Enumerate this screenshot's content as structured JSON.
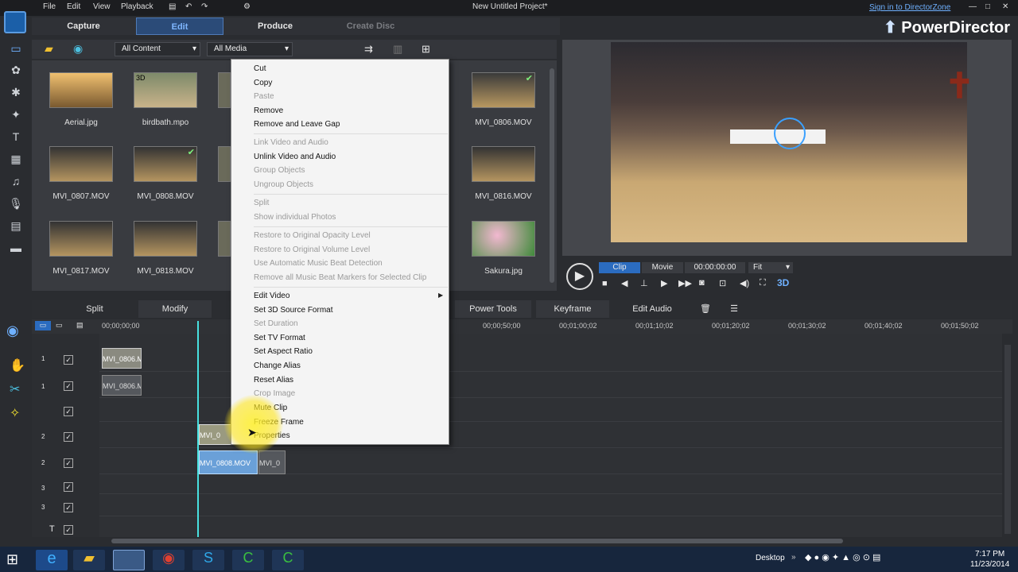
{
  "window": {
    "title": "New Untitled Project*",
    "menus": [
      "File",
      "Edit",
      "View",
      "Playback"
    ],
    "signin_link": "Sign in to DirectorZone",
    "brand": "PowerDirector"
  },
  "modes": [
    "Capture",
    "Edit",
    "Produce",
    "Create Disc"
  ],
  "media": {
    "filter_content": "All Content",
    "filter_media": "All Media",
    "items": [
      {
        "label": "Aerial.jpg"
      },
      {
        "label": "birdbath.mpo",
        "badge": "3D"
      },
      {
        "label": "MVI_0806.MOV"
      },
      {
        "label": "MVI_0807.MOV"
      },
      {
        "label": "MVI_0808.MOV"
      },
      {
        "label": "MVI_0816.MOV"
      },
      {
        "label": "MVI_0817.MOV"
      },
      {
        "label": "MVI_0818.MOV"
      },
      {
        "label": "Sakura.jpg"
      }
    ]
  },
  "player": {
    "tab_clip": "Clip",
    "tab_movie": "Movie",
    "timecode": "00:00:00:00",
    "fit": "Fit",
    "mode_3d": "3D"
  },
  "timeline_toolbar": [
    "Split",
    "Modify",
    "Power Tools",
    "Keyframe",
    "Edit Audio"
  ],
  "ruler": [
    "00;00;00;00",
    "00;00;50;00",
    "00;01;00;02",
    "00;01;10;02",
    "00;01;20;02",
    "00;01;30;02",
    "00;01;40;02",
    "00;01;50;02"
  ],
  "tracks": [
    {
      "num": "1",
      "clip": "MVI_0806.M"
    },
    {
      "num": "1",
      "clip": "MVI_0806.M"
    },
    {
      "num": "2",
      "clip": "MVI_0"
    },
    {
      "num": "2",
      "clip": "MVI_0808.MOV"
    },
    {
      "num": "2",
      "clip2": "MVI_0"
    },
    {
      "num": "3"
    },
    {
      "num": "3"
    },
    {
      "num": "T"
    }
  ],
  "context_menu": [
    {
      "label": "Cut",
      "enabled": true
    },
    {
      "label": "Copy",
      "enabled": true
    },
    {
      "label": "Paste",
      "enabled": false
    },
    {
      "label": "Remove",
      "enabled": true
    },
    {
      "label": "Remove and Leave Gap",
      "enabled": true
    },
    {
      "label": "Link Video and Audio",
      "enabled": false
    },
    {
      "label": "Unlink Video and Audio",
      "enabled": true
    },
    {
      "label": "Group Objects",
      "enabled": false
    },
    {
      "label": "Ungroup Objects",
      "enabled": false
    },
    {
      "label": "Split",
      "enabled": false
    },
    {
      "label": "Show individual Photos",
      "enabled": false
    },
    {
      "label": "Restore to Original Opacity Level",
      "enabled": false
    },
    {
      "label": "Restore to Original Volume Level",
      "enabled": false
    },
    {
      "label": "Use Automatic Music Beat Detection",
      "enabled": false
    },
    {
      "label": "Remove all Music Beat Markers for Selected Clip",
      "enabled": false
    },
    {
      "label": "Edit Video",
      "enabled": true,
      "submenu": true
    },
    {
      "label": "Set 3D Source Format",
      "enabled": true
    },
    {
      "label": "Set Duration",
      "enabled": false
    },
    {
      "label": "Set TV Format",
      "enabled": true
    },
    {
      "label": "Set Aspect Ratio",
      "enabled": true
    },
    {
      "label": "Change Alias",
      "enabled": true
    },
    {
      "label": "Reset Alias",
      "enabled": true
    },
    {
      "label": "Crop Image",
      "enabled": false
    },
    {
      "label": "Mute Clip",
      "enabled": true
    },
    {
      "label": "Freeze Frame",
      "enabled": true
    },
    {
      "label": "Properties",
      "enabled": true
    }
  ],
  "taskbar": {
    "desktop": "Desktop",
    "time": "7:17 PM",
    "date": "11/23/2014"
  }
}
